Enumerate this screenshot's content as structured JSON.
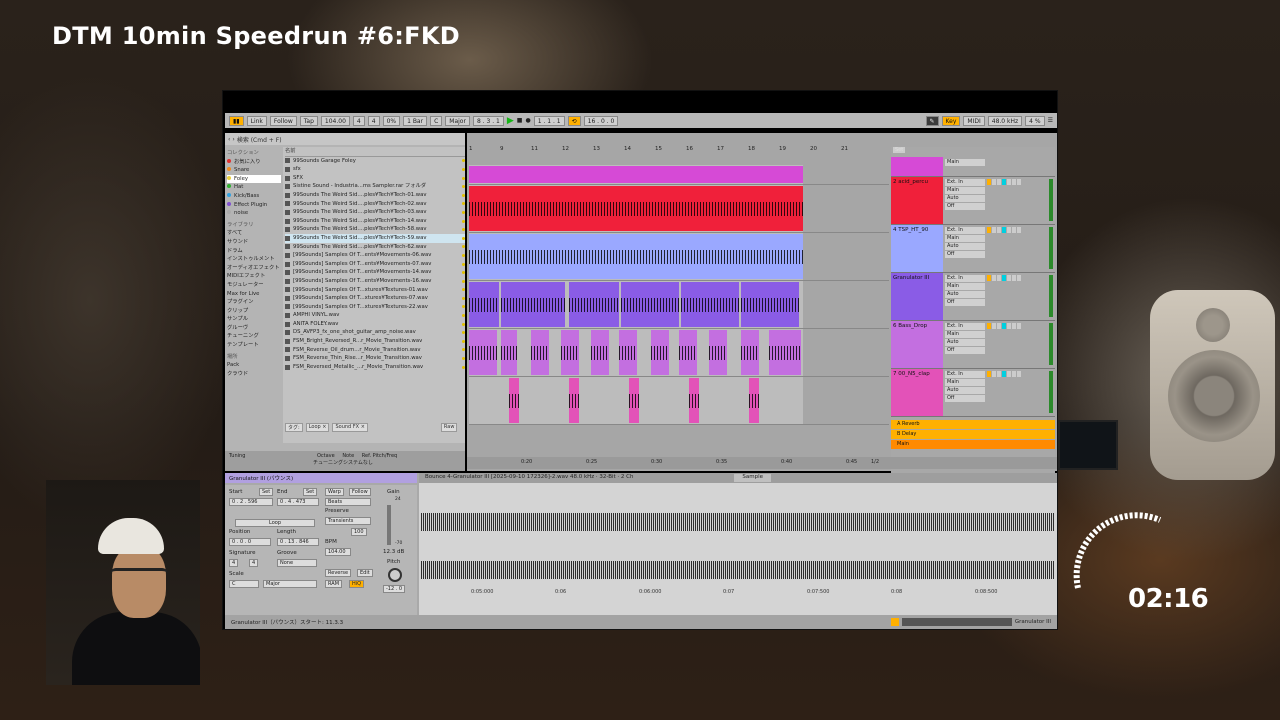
{
  "overlay": {
    "title": "DTM 10min Speedrun #6:FKD",
    "timer": "02:16"
  },
  "toolbar": {
    "link": "Link",
    "follow": "Follow",
    "tap": "Tap",
    "tempo": "104.00",
    "sig_num": "4",
    "sig_den": "4",
    "swing": "0%",
    "quant": "1 Bar",
    "key": "C",
    "scale": "Major",
    "pos": "8 . 3 . 1",
    "loop_start": "1 . 1 . 1",
    "loop_len": "16 . 0 . 0",
    "key_btn": "Key",
    "midi_btn": "MIDI",
    "sr": "48.0 kHz",
    "cpu": "4 %"
  },
  "browser": {
    "search_placeholder": "検索 (Cmd + F)",
    "collections_header": "コレクション",
    "collections": [
      {
        "label": "お気に入り",
        "color": "#e03030"
      },
      {
        "label": "Snare",
        "color": "#f08a20"
      },
      {
        "label": "Foley",
        "color": "#e8d040"
      },
      {
        "label": "Hat",
        "color": "#30b030"
      },
      {
        "label": "Kick/Bass",
        "color": "#30a0e0"
      },
      {
        "label": "Effect Plugin",
        "color": "#8050d0"
      },
      {
        "label": "noise",
        "color": "#aaaaaa"
      }
    ],
    "library_header": "ライブラリ",
    "library": [
      "すべて",
      "サウンド",
      "ドラム",
      "インストゥルメント",
      "オーディオエフェクト",
      "MIDIエフェクト",
      "モジュレーター",
      "Max for Live",
      "プラグイン",
      "クリップ",
      "サンプル",
      "グルーヴ",
      "チューニング",
      "テンプレート"
    ],
    "places_header": "場所",
    "places": [
      "Pack",
      "クラウド"
    ],
    "files_header": "名前",
    "files": [
      "99Sounds Garage Foley",
      "sfx",
      "SFX",
      "Sistine Sound - Industria...ms Sampler.rar フォルダ",
      "99Sounds The Weird Sid....ples¥Tech¥Tech-01.wav",
      "99Sounds The Weird Sid....ples¥Tech¥Tech-02.wav",
      "99Sounds The Weird Sid....ples¥Tech¥Tech-03.wav",
      "99Sounds The Weird Sid....ples¥Tech¥Tech-14.wav",
      "99Sounds The Weird Sid....ples¥Tech¥Tech-58.wav",
      "99Sounds The Weird Sid....ples¥Tech¥Tech-59.wav",
      "99Sounds The Weird Sid....ples¥Tech¥Tech-62.wav",
      "[99Sounds] Samples Of T...ents¥Movements-06.wav",
      "[99Sounds] Samples Of T...ents¥Movements-07.wav",
      "[99Sounds] Samples Of T...ents¥Movements-14.wav",
      "[99Sounds] Samples Of T...ents¥Movements-16.wav",
      "[99Sounds] Samples Of T...xtures¥Textures-01.wav",
      "[99Sounds] Samples Of T...xtures¥Textures-07.wav",
      "[99Sounds] Samples Of T...xtures¥Textures-22.wav",
      "AMPHI VINYL.wav",
      "ANITA FOLEY.wav",
      "DS_AVFP3_fx_one_shot_guitar_amp_noise.wav",
      "FSM_Bright_Reversed_R...r_Movie_Transition.wav",
      "FSM_Reverse_Oil_drum...r_Movie_Transition.wav",
      "FSM_Reverse_Thin_Rise...r_Movie_Transition.wav",
      "FSM_Reversed_Metallic_...r_Movie_Transition.wav"
    ],
    "selected_file": 9,
    "tags_label": "タグ:",
    "tags": [
      "Loop ×",
      "Sound FX ×"
    ],
    "raw": "Raw"
  },
  "info": {
    "tuning": "Tuning",
    "octave": "Octave",
    "note": "Note",
    "ref": "Ref. Pitch/Freq",
    "sys": "チューニングシステムなし"
  },
  "arrangement": {
    "ruler": [
      "1",
      "9",
      "11",
      "12",
      "13",
      "14",
      "15",
      "16",
      "17",
      "18",
      "19",
      "20",
      "21"
    ],
    "time": [
      "0:20",
      "0:25",
      "0:30",
      "0:35",
      "0:40",
      "0:45"
    ],
    "fraction": "1/2",
    "tracks": [
      {
        "name": "",
        "color": "#d64ad6"
      },
      {
        "name": "2 acid_percu",
        "color": "#f0203a"
      },
      {
        "name": "4 TSP_HT_90",
        "color": "#9aa8ff"
      },
      {
        "name": "Granulator III",
        "color": "#8a5ce6"
      },
      {
        "name": "6 Bass_Drop",
        "color": "#c36fe0"
      },
      {
        "name": "7 00_N5_clap",
        "color": "#e352b8"
      }
    ],
    "returns": [
      {
        "name": "A Reverb",
        "color": "#ffb000"
      },
      {
        "name": "B Delay",
        "color": "#ffb000"
      },
      {
        "name": "Main",
        "color": "#ff8a00"
      }
    ],
    "io_in": "Ext. In",
    "io_main": "Main",
    "io_auto": "Auto",
    "io_off": "Off",
    "set": "Set"
  },
  "clipview": {
    "title": "Granulator III (バウンス)",
    "start": "Start",
    "set": "Set",
    "end": "End",
    "start_val": "0 . 2 . 596",
    "end_val": "0 . 4 . 473",
    "loop": "Loop",
    "position": "Position",
    "length": "Length",
    "pos_val": "0 . 0 . 0",
    "len_val": "0 . 13 . 846",
    "signature": "Signature",
    "groove": "Groove",
    "sig_num": "4",
    "sig_den": "4",
    "groove_val": "None",
    "scale": "Scale",
    "scale_key": "C",
    "scale_mode": "Major",
    "warp": "Warp",
    "follow": "Follow",
    "beats": "Beats",
    "preserve": "Preserve",
    "transients": "Transients",
    "val100": "100",
    "bpm": "BPM",
    "bpm_val": "104.00",
    "reverse": "Reverse",
    "edit": "Edit",
    "ram": "RAM",
    "hiq": "HiQ",
    "gain": "Gain",
    "gain_val": "12.3 dB",
    "pitch": "Pitch",
    "pitch_val": "-12 . 0",
    "g24": "24",
    "g70": "-70"
  },
  "sample": {
    "file": "Bounce 4-Granulator III [2025-09-10 172326]-2.wav  48.0 kHz · 32-Bit · 2 Ch",
    "tab": "Sample",
    "times": [
      "0:05:000",
      "0:06",
      "0:06:000",
      "0:07",
      "0:07:500",
      "0:08",
      "0:08:500"
    ]
  },
  "status": {
    "text": "Granulator III（バウンス）スタート: 11.3.3",
    "device": "Granulator III"
  }
}
